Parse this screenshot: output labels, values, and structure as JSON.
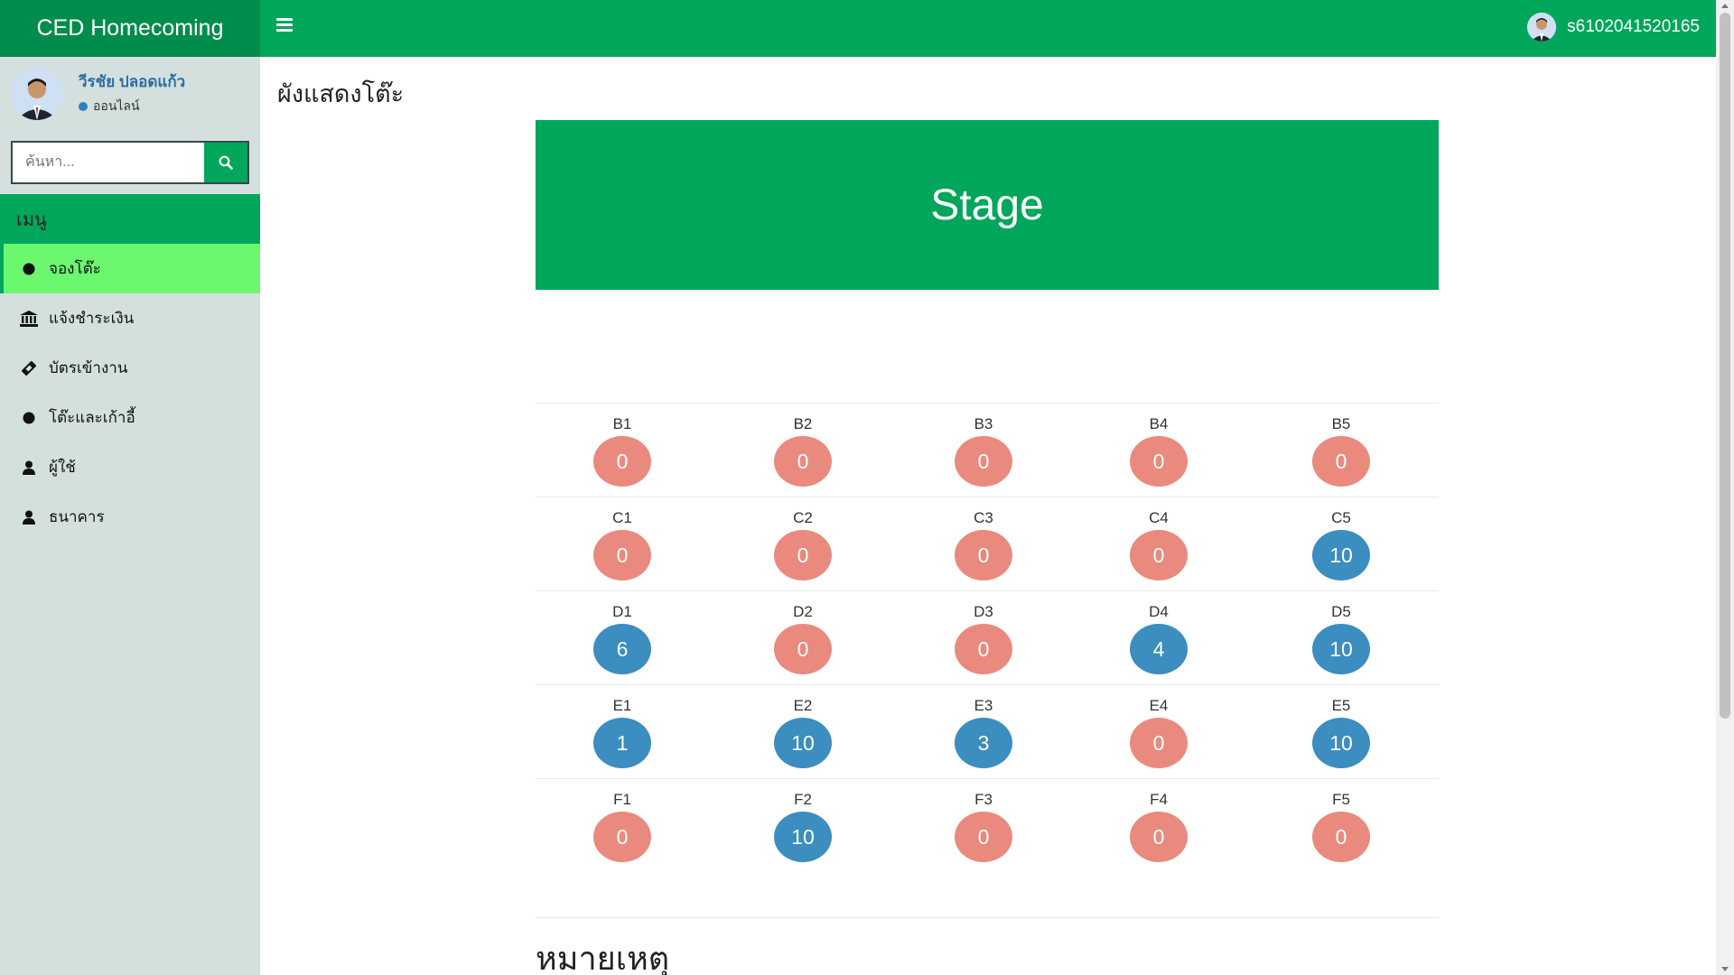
{
  "header": {
    "brand": "CED Homecoming",
    "username": "s6102041520165"
  },
  "sidebar": {
    "user_name": "วีรชัย ปลอดแก้ว",
    "user_status": "ออนไลน์",
    "search_placeholder": "ค้นหา...",
    "menu_header": "เมนู",
    "items": [
      {
        "label": "จองโต๊ะ",
        "icon": "circle-icon",
        "active": true
      },
      {
        "label": "แจ้งชำระเงิน",
        "icon": "bank-icon",
        "active": false
      },
      {
        "label": "บัตรเข้างาน",
        "icon": "ticket-icon",
        "active": false
      },
      {
        "label": "โต๊ะและเก้าอี้",
        "icon": "circle-icon",
        "active": false
      },
      {
        "label": "ผู้ใช้",
        "icon": "user-icon",
        "active": false
      },
      {
        "label": "ธนาคาร",
        "icon": "user-icon",
        "active": false
      }
    ]
  },
  "main": {
    "title": "ผังแสดงโต๊ะ",
    "stage_label": "Stage",
    "note_title": "หมายเหตุ"
  },
  "seating": {
    "colors": {
      "empty": "#ea8a7e",
      "booked": "#3c8dc0"
    },
    "rows": [
      [
        {
          "name": "B1",
          "count": "0"
        },
        {
          "name": "B2",
          "count": "0"
        },
        {
          "name": "B3",
          "count": "0"
        },
        {
          "name": "B4",
          "count": "0"
        },
        {
          "name": "B5",
          "count": "0"
        }
      ],
      [
        {
          "name": "C1",
          "count": "0"
        },
        {
          "name": "C2",
          "count": "0"
        },
        {
          "name": "C3",
          "count": "0"
        },
        {
          "name": "C4",
          "count": "0"
        },
        {
          "name": "C5",
          "count": "10"
        }
      ],
      [
        {
          "name": "D1",
          "count": "6"
        },
        {
          "name": "D2",
          "count": "0"
        },
        {
          "name": "D3",
          "count": "0"
        },
        {
          "name": "D4",
          "count": "4"
        },
        {
          "name": "D5",
          "count": "10"
        }
      ],
      [
        {
          "name": "E1",
          "count": "1"
        },
        {
          "name": "E2",
          "count": "10"
        },
        {
          "name": "E3",
          "count": "3"
        },
        {
          "name": "E4",
          "count": "0"
        },
        {
          "name": "E5",
          "count": "10"
        }
      ],
      [
        {
          "name": "F1",
          "count": "0"
        },
        {
          "name": "F2",
          "count": "10"
        },
        {
          "name": "F3",
          "count": "0"
        },
        {
          "name": "F4",
          "count": "0"
        },
        {
          "name": "F5",
          "count": "0"
        }
      ]
    ]
  }
}
